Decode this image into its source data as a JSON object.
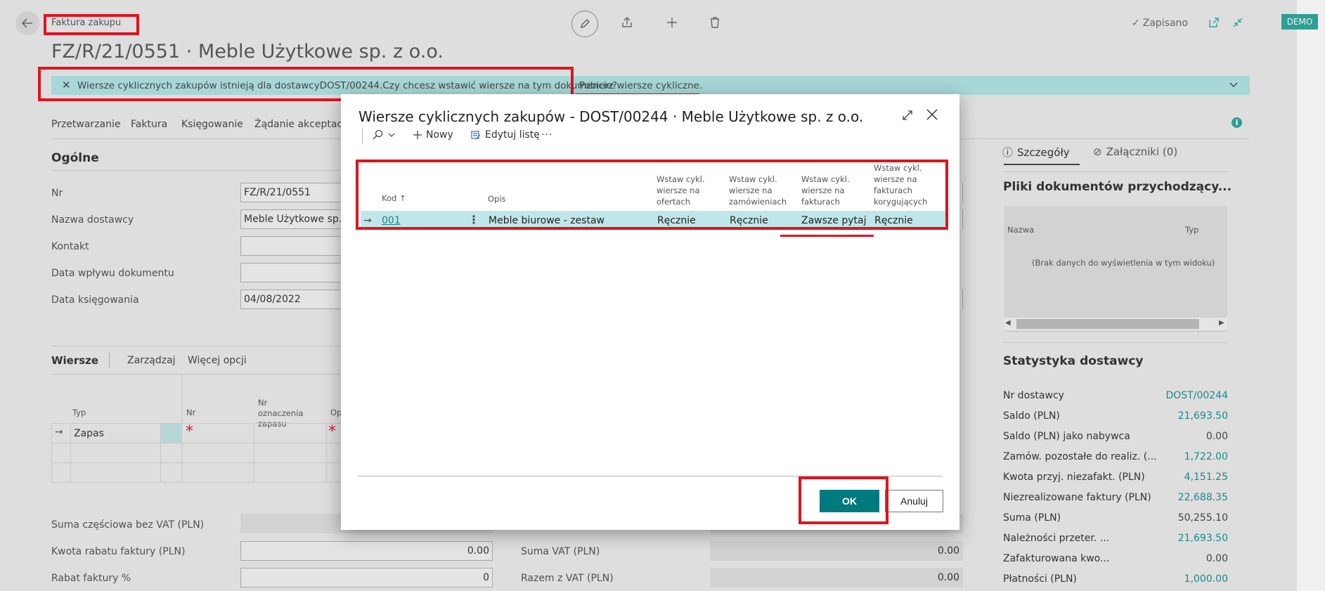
{
  "header": {
    "breadcrumb": "Faktura zakupu",
    "doc_title": "FZ/R/21/0551 · Meble Użytkowe sp. z o.o.",
    "saved_label": "Zapisano",
    "demo_badge": "DEMO"
  },
  "notification": {
    "message": "Wiersze cyklicznych zakupów istnieją dla dostawcyDOST/00244.Czy chcesz wstawić wiersze na tym dokumencie?",
    "action": "Pobierz wiersze cykliczne."
  },
  "action_bar": [
    "Przetwarzanie",
    "Faktura",
    "Księgowanie",
    "Żądanie akceptacji"
  ],
  "general": {
    "section_title": "Ogólne",
    "fields": [
      {
        "label": "Nr",
        "value": "FZ/R/21/0551"
      },
      {
        "label": "Nazwa dostawcy",
        "value": "Meble Użytkowe sp. z"
      },
      {
        "label": "Kontakt",
        "value": ""
      },
      {
        "label": "Data wpływu dokumentu",
        "value": ""
      },
      {
        "label": "Data księgowania",
        "value": "04/08/2022"
      }
    ]
  },
  "lines": {
    "tabs": [
      "Wiersze",
      "Zarządzaj",
      "Więcej opcji"
    ],
    "columns": [
      "Typ",
      "Nr",
      "Nr oznaczenia zapasu",
      "Op"
    ],
    "first_row_type": "Zapas"
  },
  "totals": {
    "left": [
      {
        "label": "Suma częściowa bez VAT (PLN)",
        "value": ""
      },
      {
        "label": "Kwota rabatu faktury (PLN)",
        "value": "0.00"
      },
      {
        "label": "Rabat faktury %",
        "value": "0"
      }
    ],
    "right": [
      {
        "label": "Suma VAT (PLN)",
        "value": "0.00"
      },
      {
        "label": "Razem z VAT (PLN)",
        "value": "0.00"
      }
    ]
  },
  "factbox": {
    "tabs": [
      "Szczegóły",
      "Załączniki (0)"
    ],
    "incoming_title": "Pliki dokumentów przychodzący...",
    "incoming_cols": [
      "Nazwa",
      "Typ"
    ],
    "incoming_empty": "(Brak danych do wyświetlenia w tym widoku)",
    "stats_title": "Statystyka dostawcy",
    "stats": [
      {
        "label": "Nr dostawcy",
        "value": "DOST/00244",
        "link": true
      },
      {
        "label": "Saldo (PLN)",
        "value": "21,693.50",
        "link": true
      },
      {
        "label": "Saldo (PLN) jako nabywca",
        "value": "0.00",
        "link": false
      },
      {
        "label": "Zamów. pozostałe do realiz. (...",
        "value": "1,722.00",
        "link": true
      },
      {
        "label": "Kwota przyj. niezafakt. (PLN)",
        "value": "4,151.25",
        "link": true
      },
      {
        "label": "Niezrealizowane faktury (PLN)",
        "value": "22,688.35",
        "link": true
      },
      {
        "label": "Suma (PLN)",
        "value": "50,255.10",
        "link": false
      },
      {
        "label": "Należności przeter. ...",
        "value": "21,693.50",
        "link": true
      },
      {
        "label": "Zafakturowana kwo...",
        "value": "0.00",
        "link": false
      },
      {
        "label": "Płatności (PLN)",
        "value": "1,000.00",
        "link": true
      }
    ]
  },
  "dialog": {
    "title": "Wiersze cyklicznych zakupów - DOST/00244 · Meble Użytkowe sp. z o.o.",
    "toolbar": {
      "new": "Nowy",
      "edit_list": "Edytuj listę"
    },
    "columns": {
      "kod": "Kod",
      "opis": "Opis",
      "oferty": "Wstaw cykl. wiersze na ofertach",
      "zamowienia": "Wstaw cykl. wiersze na zamówieniach",
      "faktury": "Wstaw cykl. wiersze na fakturach",
      "korygujace": "Wstaw cykl. wiersze na fakturach korygujących"
    },
    "row": {
      "kod": "001",
      "opis": "Meble biurowe - zestaw",
      "oferty": "Ręcznie",
      "zamowienia": "Ręcznie",
      "faktury": "Zawsze pytaj",
      "korygujace": "Ręcznie"
    },
    "ok": "OK",
    "cancel": "Anuluj"
  }
}
